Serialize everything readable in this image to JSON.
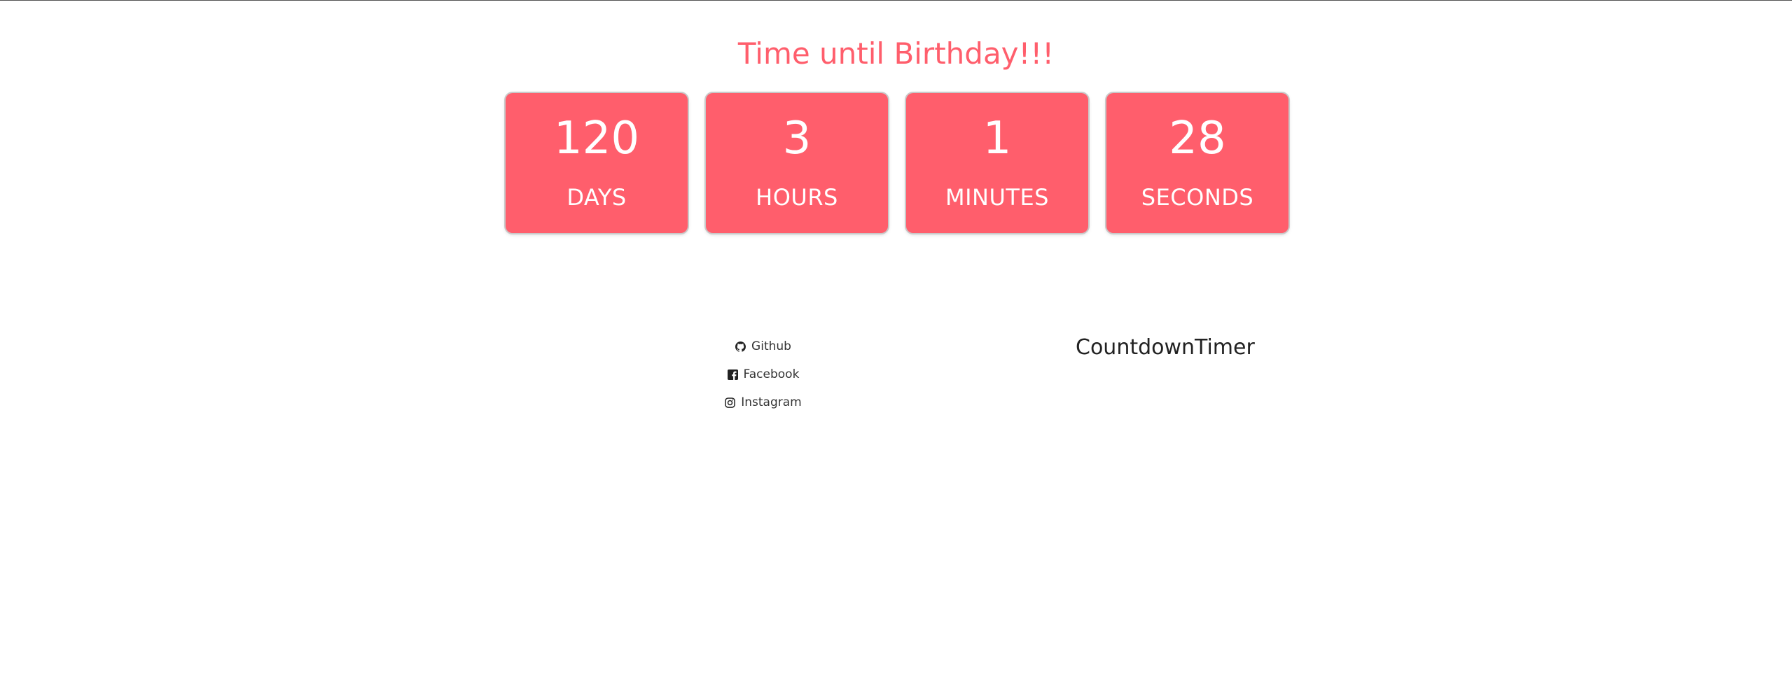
{
  "page": {
    "title": "Time until Birthday!!!",
    "accent_color": "#ff5e6c"
  },
  "timer": {
    "units": [
      {
        "value": "120",
        "label": "DAYS"
      },
      {
        "value": "3",
        "label": "HOURS"
      },
      {
        "value": "1",
        "label": "MINUTES"
      },
      {
        "value": "28",
        "label": "SECONDS"
      }
    ]
  },
  "footer": {
    "links": [
      {
        "label": "Github",
        "icon": "github-icon"
      },
      {
        "label": "Facebook",
        "icon": "facebook-icon"
      },
      {
        "label": "Instagram",
        "icon": "instagram-icon"
      }
    ],
    "brand": "CountdownTimer"
  }
}
